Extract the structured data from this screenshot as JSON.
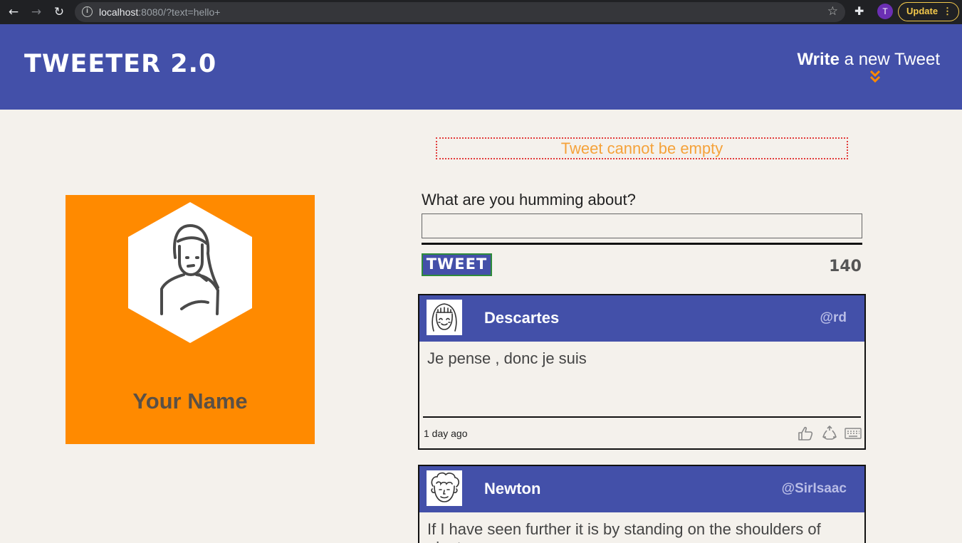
{
  "browser": {
    "url_host": "localhost",
    "url_rest": ":8080/?text=hello+",
    "profile_initial": "T",
    "update_label": "Update"
  },
  "header": {
    "brand": "TWEETER 2.0",
    "write_bold": "Write",
    "write_rest": " a new Tweet"
  },
  "error": {
    "message": "Tweet cannot be empty"
  },
  "profile": {
    "name": "Your Name"
  },
  "composer": {
    "label": "What are you humming about?",
    "value": "",
    "submit_label": "TWEET",
    "counter": "140"
  },
  "tweets": [
    {
      "name": "Descartes",
      "handle": "@rd",
      "text": "Je pense , donc je suis",
      "time": "1 day ago"
    },
    {
      "name": "Newton",
      "handle": "@SirIsaac",
      "text": "If I have seen further it is by standing on the shoulders of giants",
      "time": ""
    }
  ],
  "colors": {
    "header_bg": "#4350a9",
    "page_bg": "#f4f1ec",
    "profile_bg": "#ff8a00",
    "error_text": "#f5a23a",
    "error_border": "#e23b3b",
    "chevron": "#ff8a00"
  },
  "icons": [
    "back-icon",
    "forward-icon",
    "reload-icon",
    "info-icon",
    "star-icon",
    "puzzle-icon",
    "chevron-double-down-icon",
    "like-icon",
    "retweet-icon",
    "keyboard-icon"
  ]
}
